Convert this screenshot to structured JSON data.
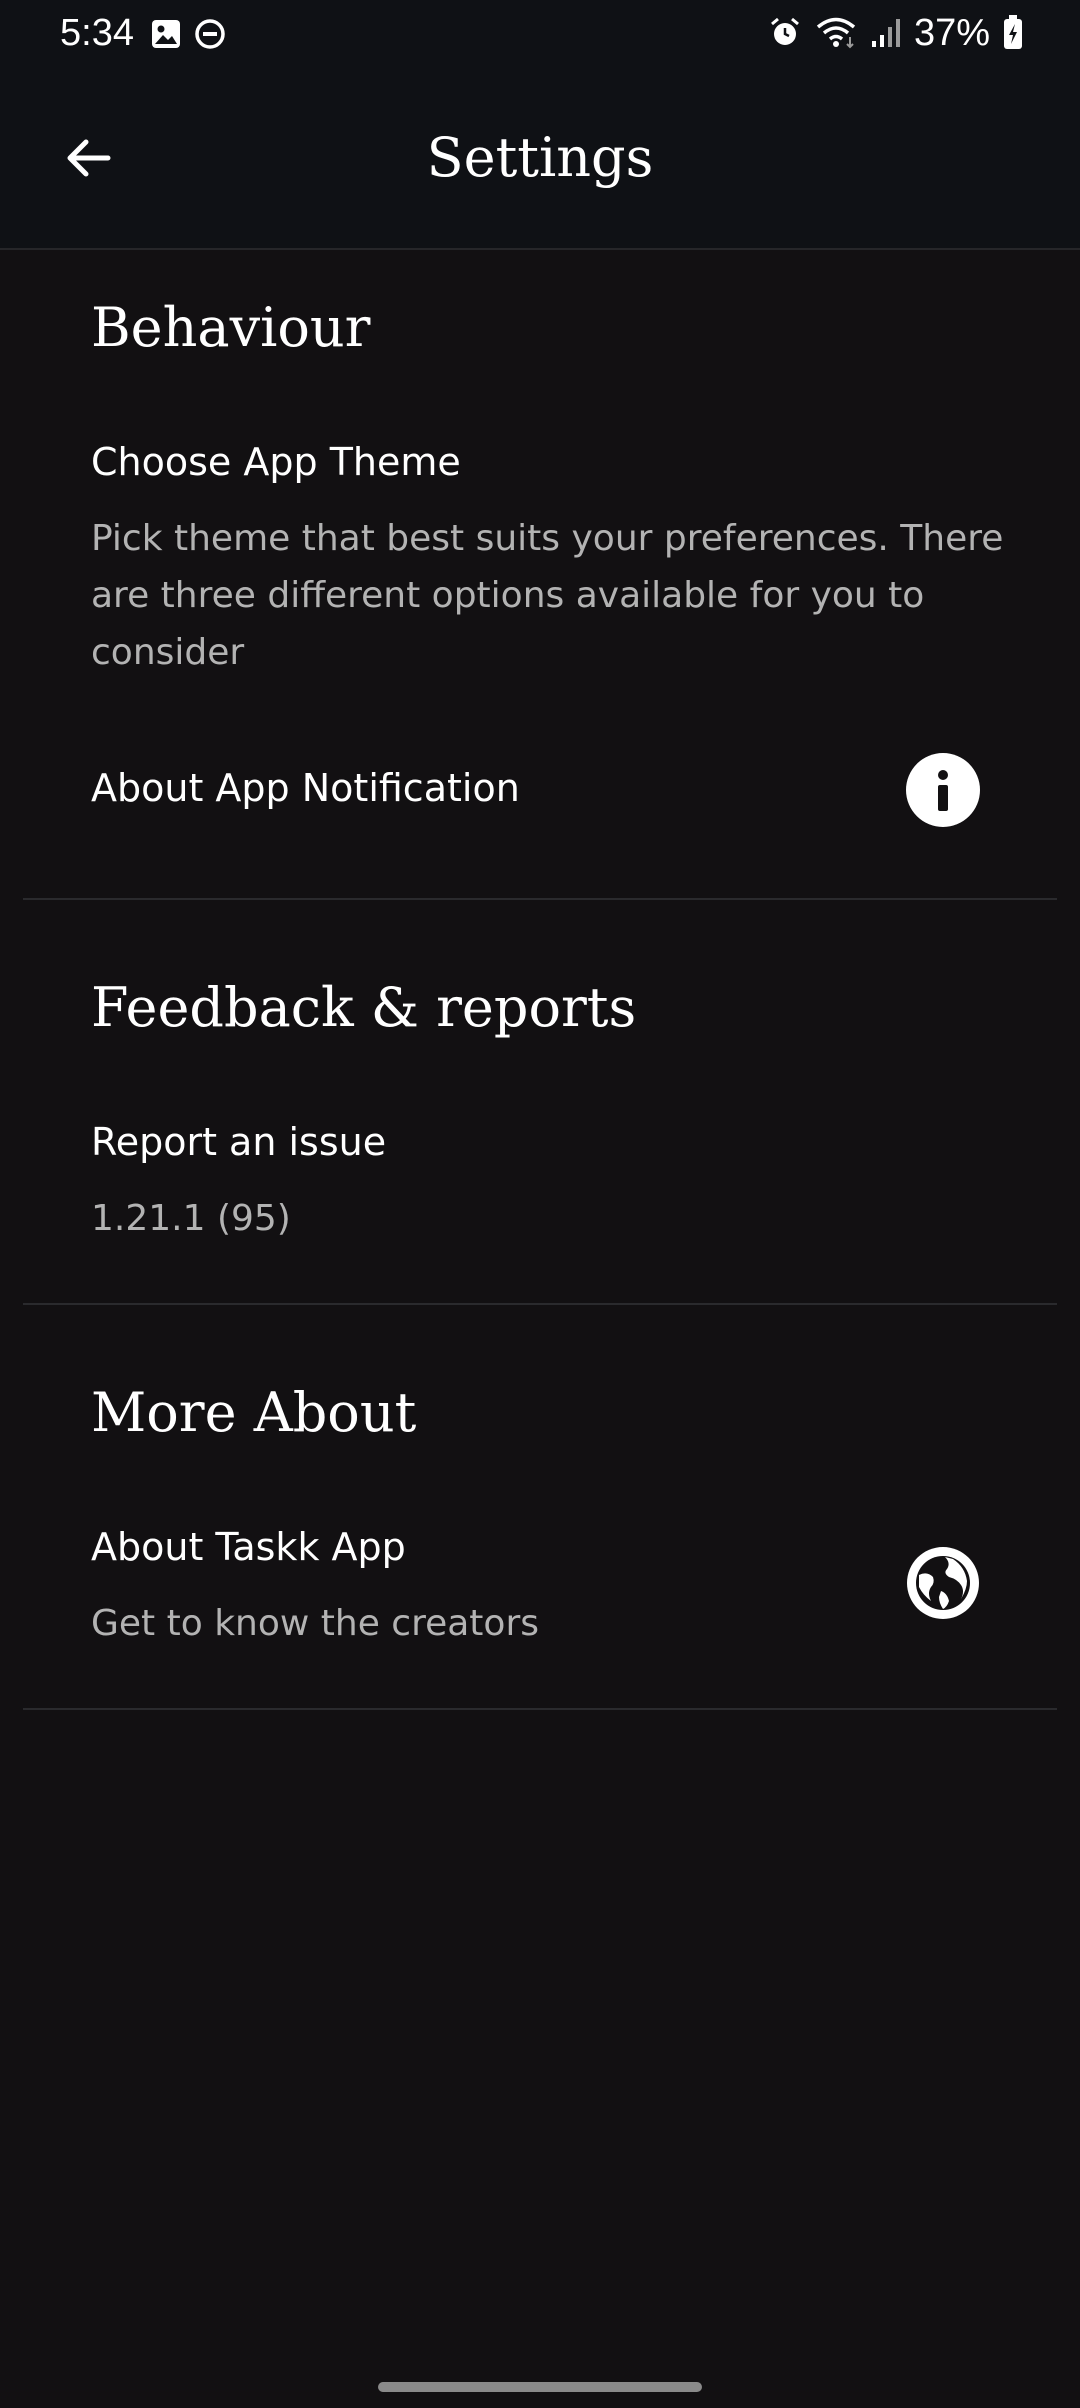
{
  "status_bar": {
    "time": "5:34",
    "battery_percent": "37%",
    "left_icons": [
      "gallery-icon",
      "do-not-disturb-icon"
    ],
    "right_icons": [
      "alarm-icon",
      "wifi-icon",
      "signal-icon",
      "battery-charging-icon"
    ]
  },
  "app_bar": {
    "title": "Settings",
    "back_icon": "back-arrow-icon"
  },
  "sections": {
    "behaviour": {
      "header": "Behaviour",
      "items": {
        "theme": {
          "title": "Choose App Theme",
          "subtitle": "Pick theme that best suits your preferences. There are three different options available for you to consider"
        },
        "notification": {
          "title": "About App Notification",
          "icon": "info-icon"
        }
      }
    },
    "feedback": {
      "header": "Feedback & reports",
      "items": {
        "report": {
          "title": "Report an issue",
          "subtitle": "1.21.1 (95)"
        }
      }
    },
    "more_about": {
      "header": "More About",
      "items": {
        "about": {
          "title": "About Taskk App",
          "subtitle": "Get to know the creators",
          "icon": "globe-icon"
        }
      }
    }
  },
  "colors": {
    "background": "#121012",
    "app_bar": "#0f1115",
    "text_primary": "#ffffff",
    "text_secondary": "#b3b3b3",
    "divider": "#2a2a2d"
  }
}
